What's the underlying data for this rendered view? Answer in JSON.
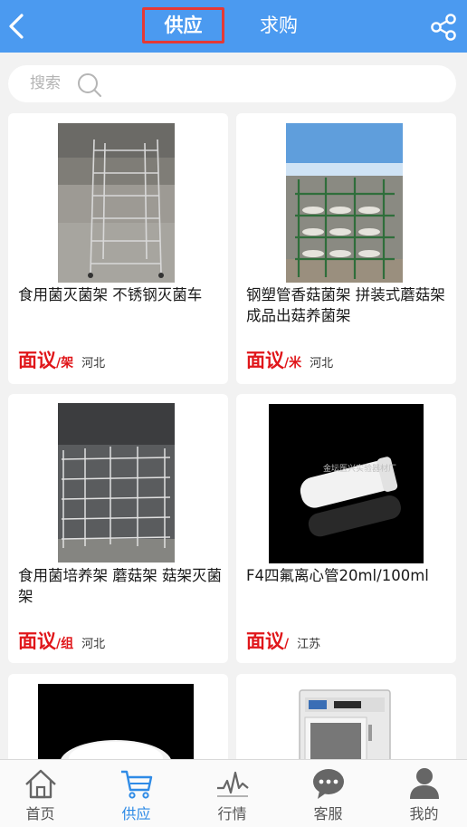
{
  "header": {
    "tabs": [
      "供应",
      "求购"
    ]
  },
  "search": {
    "placeholder": "搜索"
  },
  "products": [
    {
      "title": "食用菌灭菌架 不锈钢灭菌车",
      "price": "面议",
      "unit": "/架",
      "region": "河北"
    },
    {
      "title": "钢塑管香菇菌架 拼装式蘑菇架 成品出菇养菌架",
      "price": "面议",
      "unit": "/米",
      "region": "河北"
    },
    {
      "title": "食用菌培养架 蘑菇架 菇架灭菌架",
      "price": "面议",
      "unit": "/组",
      "region": "河北"
    },
    {
      "title": "F4四氟离心管20ml/100ml",
      "price": "面议",
      "unit": "/",
      "region": "江苏",
      "watermark": "金坛医兴实验器材厂"
    }
  ],
  "tabbar": {
    "items": [
      {
        "label": "首页",
        "icon": "home-icon"
      },
      {
        "label": "供应",
        "icon": "cart-icon"
      },
      {
        "label": "行情",
        "icon": "trend-icon"
      },
      {
        "label": "客服",
        "icon": "chat-icon"
      },
      {
        "label": "我的",
        "icon": "user-icon"
      }
    ],
    "active": 1
  },
  "colors": {
    "header": "#4b9af0",
    "price": "#e0161a",
    "active_tab": "#2f8be6",
    "tab_highlight": "#e53935"
  }
}
